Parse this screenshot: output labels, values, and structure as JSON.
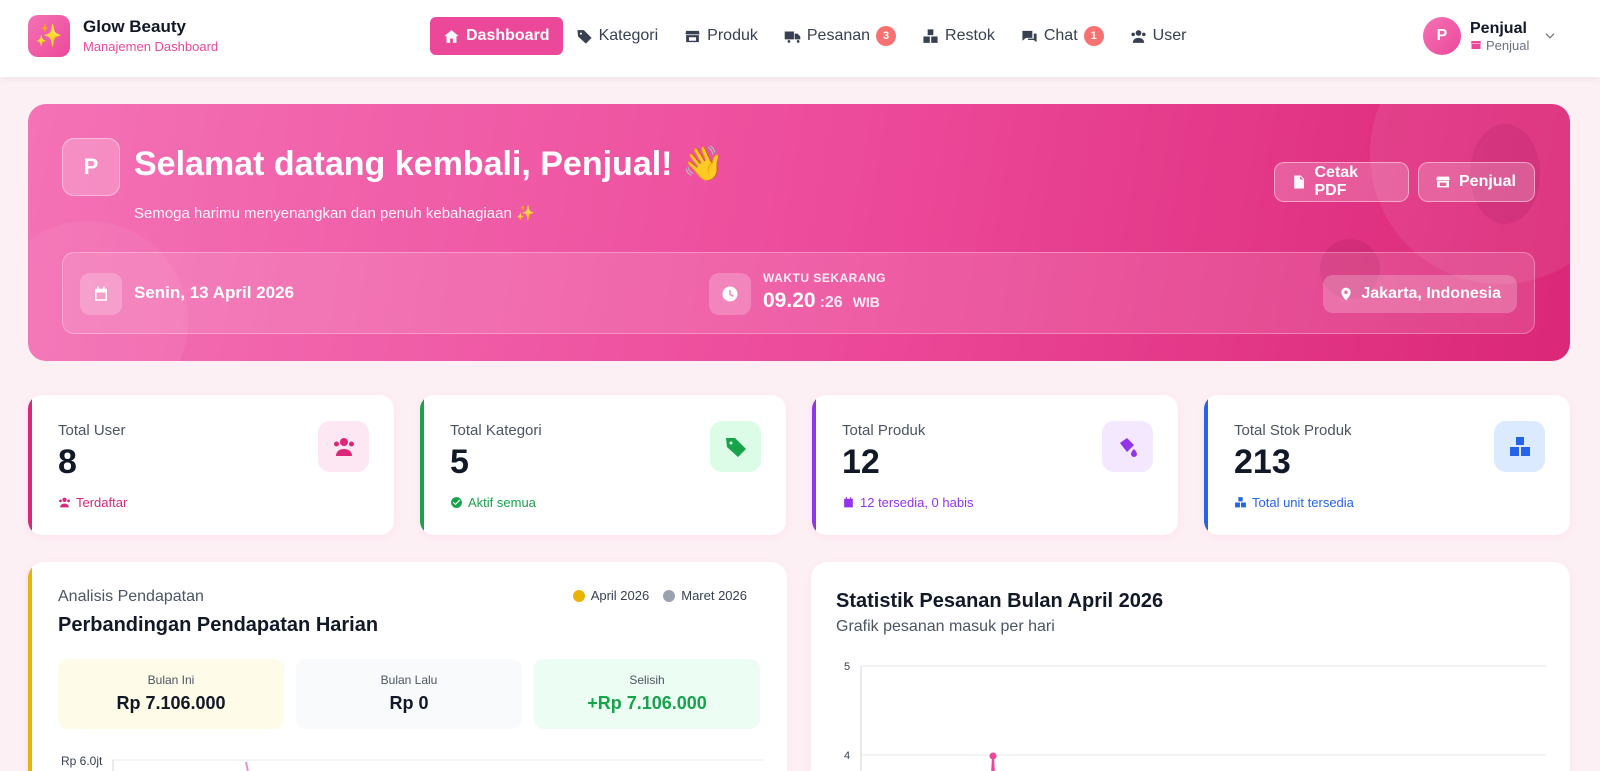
{
  "brand": {
    "name": "Glow Beauty",
    "subtitle": "Manajemen Dashboard"
  },
  "nav": [
    {
      "label": "Dashboard",
      "icon": "home-icon",
      "active": true
    },
    {
      "label": "Kategori",
      "icon": "tag-icon"
    },
    {
      "label": "Produk",
      "icon": "store-icon"
    },
    {
      "label": "Pesanan",
      "icon": "truck-icon",
      "badge": "3"
    },
    {
      "label": "Restok",
      "icon": "boxes-icon"
    },
    {
      "label": "Chat",
      "icon": "chat-icon",
      "badge": "1"
    },
    {
      "label": "User",
      "icon": "users-icon"
    }
  ],
  "user": {
    "initial": "P",
    "name": "Penjual",
    "role": "Penjual"
  },
  "hero": {
    "avatar_initial": "P",
    "title": "Selamat datang kembali, Penjual! 👋",
    "subtitle": "Semoga harimu menyenangkan dan penuh kebahagiaan ✨",
    "btn_pdf": "Cetak PDF",
    "btn_role": "Penjual",
    "date": "Senin, 13 April 2026",
    "time_label": "WAKTU SEKARANG",
    "time_main": "09.20",
    "time_sec": ":26",
    "time_zone": "WIB",
    "location": "Jakarta, Indonesia"
  },
  "stats": [
    {
      "label": "Total User",
      "value": "8",
      "foot": "Terdaftar",
      "accent": "#db2777",
      "soft": "#fce7f3",
      "icon": "users-icon"
    },
    {
      "label": "Total Kategori",
      "value": "5",
      "foot": "Aktif semua",
      "accent": "#16a34a",
      "soft": "#dcfce7",
      "icon": "tags-icon"
    },
    {
      "label": "Total Produk",
      "value": "12",
      "foot": "12 tersedia, 0 habis",
      "accent": "#9333ea",
      "soft": "#f3e8ff",
      "icon": "bottle-icon"
    },
    {
      "label": "Total Stok Produk",
      "value": "213",
      "foot": "Total unit tersedia",
      "accent": "#2563eb",
      "soft": "#dbeafe",
      "icon": "cubes-icon"
    }
  ],
  "revenue": {
    "label": "Analisis Pendapatan",
    "title": "Perbandingan Pendapatan Harian",
    "legend": [
      {
        "name": "April 2026",
        "color": "#eab308"
      },
      {
        "name": "Maret 2026",
        "color": "#9ca3af"
      }
    ],
    "summary": [
      {
        "label": "Bulan Ini",
        "value": "Rp 7.106.000"
      },
      {
        "label": "Bulan Lalu",
        "value": "Rp 0"
      },
      {
        "label": "Selisih",
        "value": "+Rp 7.106.000"
      }
    ],
    "y_tick": "Rp 6.0jt"
  },
  "orders": {
    "title": "Statistik Pesanan Bulan April 2026",
    "subtitle": "Grafik pesanan masuk per hari",
    "y_ticks": [
      "5",
      "4"
    ]
  }
}
